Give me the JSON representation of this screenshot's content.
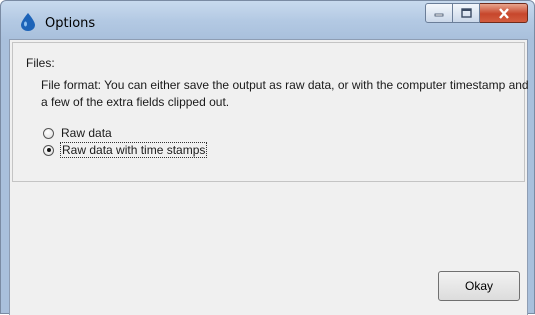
{
  "window": {
    "title": "Options",
    "caption_buttons": [
      "minimize-icon",
      "maximize-icon",
      "close-icon"
    ]
  },
  "files_group": {
    "label": "Files:",
    "description": "File format:  You can either save the output as raw data, or with the computer timestamp and a few of the extra fields clipped out.",
    "options": [
      {
        "label": "Raw data",
        "checked": false
      },
      {
        "label": "Raw data with time stamps",
        "checked": true
      }
    ]
  },
  "footer": {
    "okay_label": "Okay"
  },
  "colors": {
    "titlebar": "#b3c9e3",
    "client_bg": "#f0f0f0",
    "close_button": "#c7472c"
  }
}
